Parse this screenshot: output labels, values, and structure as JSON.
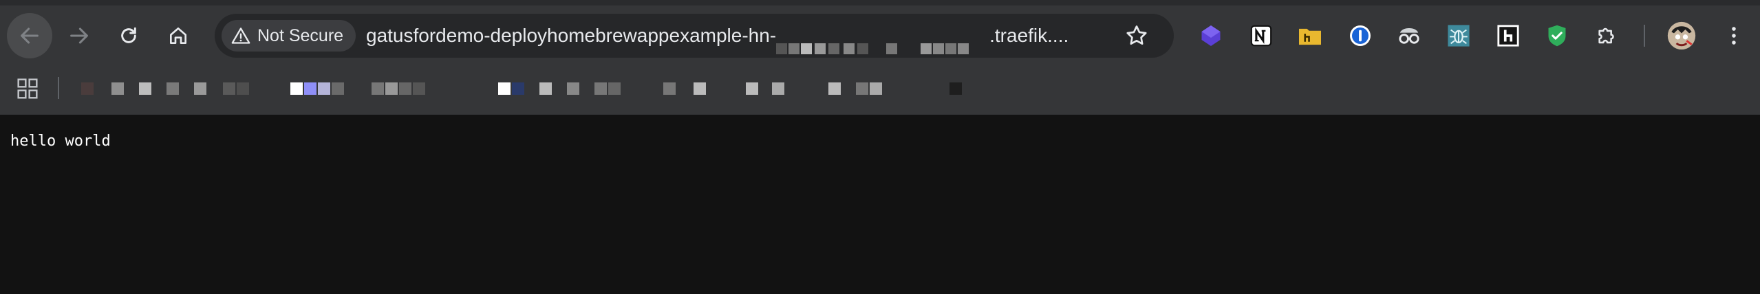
{
  "toolbar": {
    "security_chip_label": "Not Secure",
    "url_prefix": "gatusfordemo-deployhomebrewappexample-hn-",
    "url_suffix": ".traefik...."
  },
  "extensions": [
    {
      "name": "crystal-icon"
    },
    {
      "name": "notion-icon"
    },
    {
      "name": "folder-icon"
    },
    {
      "name": "password-manager-icon"
    },
    {
      "name": "spy-glasses-icon"
    },
    {
      "name": "bug-icon"
    },
    {
      "name": "dark-h-icon"
    },
    {
      "name": "shield-check-icon"
    },
    {
      "name": "puzzle-icon"
    }
  ],
  "page": {
    "body_text": "hello world"
  },
  "colors": {
    "toolbar_bg": "#353638",
    "omnibox_bg": "#262729",
    "page_bg": "#121212",
    "text": "#e8eaed"
  }
}
